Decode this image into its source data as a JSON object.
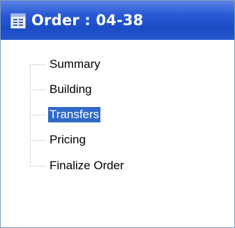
{
  "window": {
    "title": "Order : 04-38",
    "icon": "document-icon"
  },
  "tree": {
    "items": [
      {
        "label": "Summary",
        "selected": false
      },
      {
        "label": "Building",
        "selected": false
      },
      {
        "label": "Transfers",
        "selected": true
      },
      {
        "label": "Pricing",
        "selected": false
      },
      {
        "label": "Finalize Order",
        "selected": false
      }
    ]
  },
  "colors": {
    "titlebar": "#2a5bd4",
    "selection": "#316ac5",
    "border": "#7f9db9"
  }
}
